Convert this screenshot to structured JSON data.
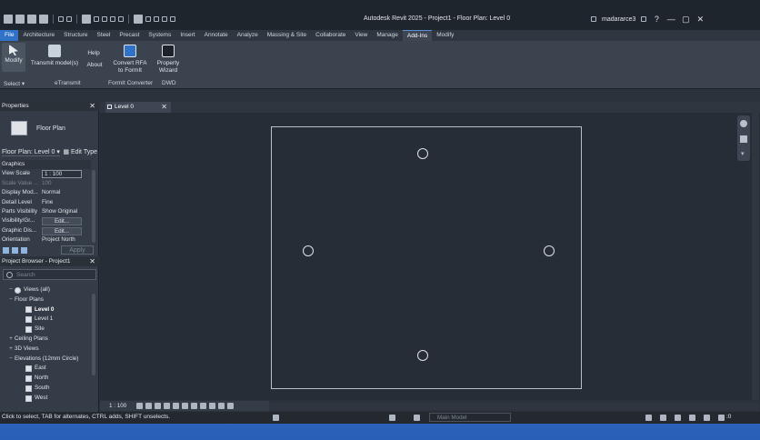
{
  "titlebar": {
    "title": "Autodesk Revit 2025 - Project1 - Floor Plan: Level 0",
    "user": "madararce3",
    "help": "?",
    "minimize": "—",
    "maximize": "▢",
    "close": "✕"
  },
  "tabs": [
    "File",
    "Architecture",
    "Structure",
    "Steel",
    "Precast",
    "Systems",
    "Insert",
    "Annotate",
    "Analyze",
    "Massing & Site",
    "Collaborate",
    "View",
    "Manage",
    "Add-Ins",
    "Modify"
  ],
  "active_tab": "Add-Ins",
  "ribbon": {
    "buttons": [
      {
        "label": "Modify"
      },
      {
        "label": "Transmit model(s)"
      },
      {
        "label": "Help"
      },
      {
        "label": "About"
      },
      {
        "label": "Convert RFA to FormIt"
      },
      {
        "label": "Property Wizard"
      }
    ],
    "panels": [
      "Select",
      "eTransmit",
      "FormIt Converter",
      "DWD"
    ]
  },
  "properties": {
    "header": "Properties",
    "type_name": "Floor Plan",
    "instance_filter": "Floor Plan: Level 0",
    "edit_type": "Edit Type",
    "group": "Graphics",
    "rows": [
      {
        "key": "View Scale",
        "value": "1 : 100",
        "kind": "box"
      },
      {
        "key": "Scale Value ...",
        "value": "100",
        "kind": "dim"
      },
      {
        "key": "Display Mod...",
        "value": "Normal",
        "kind": "text"
      },
      {
        "key": "Detail Level",
        "value": "Fine",
        "kind": "text"
      },
      {
        "key": "Parts Visibility",
        "value": "Show Original",
        "kind": "text"
      },
      {
        "key": "Visibility/Gr...",
        "value": "Edit...",
        "kind": "btn"
      },
      {
        "key": "Graphic Dis...",
        "value": "Edit...",
        "kind": "btn"
      },
      {
        "key": "Orientation",
        "value": "Project North",
        "kind": "text"
      }
    ],
    "apply": "Apply"
  },
  "browser": {
    "header": "Project Browser - Project1",
    "search_placeholder": "Search",
    "items": [
      {
        "toggle": "−",
        "label": "Views (all)",
        "indent": 8,
        "icon": "views"
      },
      {
        "toggle": "−",
        "label": "Floor Plans",
        "indent": 8
      },
      {
        "label": "Level 0",
        "indent": 28,
        "icon": "view",
        "bold": true
      },
      {
        "label": "Level 1",
        "indent": 28,
        "icon": "view"
      },
      {
        "label": "Site",
        "indent": 28,
        "icon": "view"
      },
      {
        "toggle": "+",
        "label": "Ceiling Plans",
        "indent": 8
      },
      {
        "toggle": "+",
        "label": "3D Views",
        "indent": 8
      },
      {
        "toggle": "−",
        "label": "Elevations (12mm Circle)",
        "indent": 8
      },
      {
        "label": "East",
        "indent": 28,
        "icon": "view"
      },
      {
        "label": "North",
        "indent": 28,
        "icon": "view"
      },
      {
        "label": "South",
        "indent": 28,
        "icon": "view"
      },
      {
        "label": "West",
        "indent": 28,
        "icon": "view"
      }
    ]
  },
  "view": {
    "tab_label": "Level 0",
    "scale": "1 : 100"
  },
  "status": {
    "hint": "Click to select, TAB for alternates, CTRL adds, SHIFT unselects.",
    "model": "Main Model",
    "filter_count": ":0"
  }
}
